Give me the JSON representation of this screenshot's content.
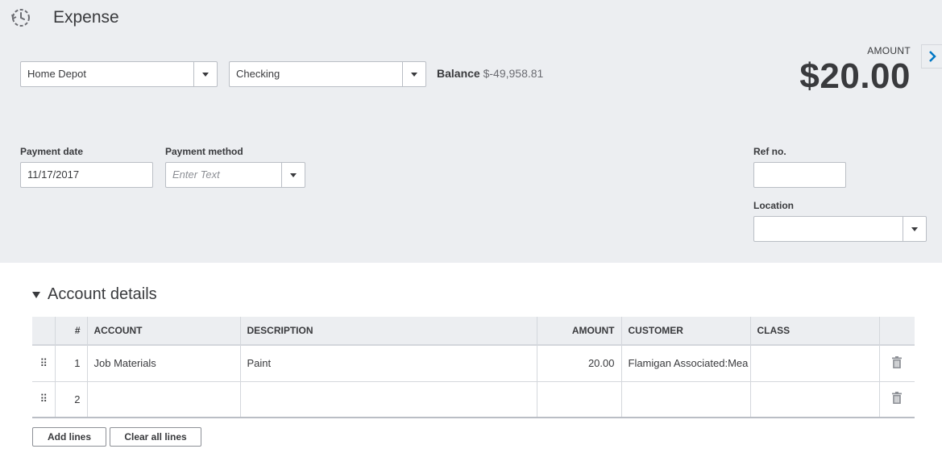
{
  "header": {
    "title": "Expense",
    "icon": "recent-transactions-icon"
  },
  "payee": {
    "value": "Home Depot"
  },
  "payment_account": {
    "value": "Checking"
  },
  "balance": {
    "label": "Balance",
    "value": "$-49,958.81"
  },
  "amount": {
    "label": "AMOUNT",
    "value": "$20.00"
  },
  "fields": {
    "payment_date_label": "Payment date",
    "payment_date_value": "11/17/2017",
    "payment_method_label": "Payment method",
    "payment_method_placeholder": "Enter Text",
    "ref_no_label": "Ref no.",
    "ref_no_value": "",
    "location_label": "Location",
    "location_value": ""
  },
  "account_details": {
    "title": "Account details",
    "columns": [
      "#",
      "ACCOUNT",
      "DESCRIPTION",
      "AMOUNT",
      "CUSTOMER",
      "CLASS"
    ],
    "rows": [
      {
        "num": "1",
        "account": "Job Materials",
        "description": "Paint",
        "amount": "20.00",
        "customer": "Flamigan Associated:Mea",
        "class": ""
      },
      {
        "num": "2",
        "account": "",
        "description": "",
        "amount": "",
        "customer": "",
        "class": ""
      }
    ]
  },
  "buttons": {
    "add_lines": "Add lines",
    "clear_all_lines": "Clear all lines"
  },
  "colors": {
    "header_bg": "#eceef1",
    "text": "#393a3d",
    "border": "#babec5",
    "accent": "#0077c5"
  }
}
